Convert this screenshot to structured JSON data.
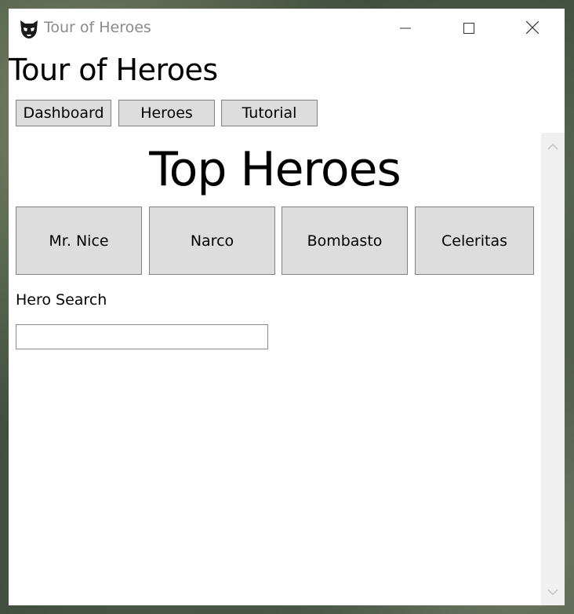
{
  "window": {
    "title": "Tour of Heroes",
    "controls": {
      "minimize": "minimize-icon",
      "maximize": "maximize-icon",
      "close": "close-icon"
    }
  },
  "app": {
    "heading": "Tour of Heroes",
    "nav": [
      {
        "label": "Dashboard"
      },
      {
        "label": "Heroes"
      },
      {
        "label": "Tutorial"
      }
    ]
  },
  "dashboard": {
    "title": "Top Heroes",
    "heroes": [
      {
        "name": "Mr. Nice"
      },
      {
        "name": "Narco"
      },
      {
        "name": "Bombasto"
      },
      {
        "name": "Celeritas"
      }
    ]
  },
  "search": {
    "label": "Hero Search",
    "value": "",
    "placeholder": ""
  },
  "colors": {
    "button_background": "#dddddd",
    "button_border": "#808080",
    "title_text": "#8a8a8a",
    "scrollbar_track": "#f0f0f0"
  },
  "icons": {
    "app": "helmet-icon",
    "scroll_up": "chevron-up-icon",
    "scroll_down": "chevron-down-icon"
  }
}
